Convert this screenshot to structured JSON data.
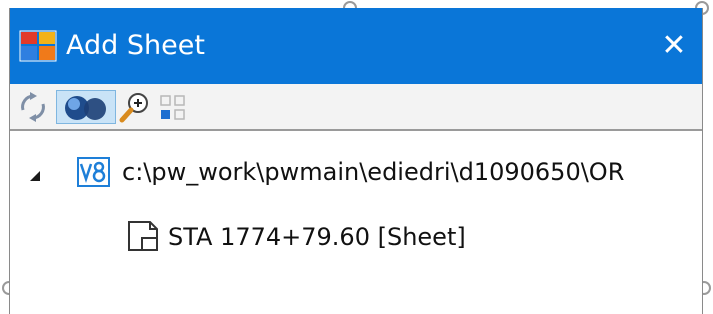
{
  "window": {
    "title": "Add Sheet",
    "close_glyph": "✕"
  },
  "toolbar": {
    "buttons": [
      {
        "name": "refresh-icon",
        "pressed": false
      },
      {
        "name": "globe-icon",
        "pressed": true
      },
      {
        "name": "zoom-in-icon",
        "pressed": false
      },
      {
        "name": "select-grid-icon",
        "pressed": false
      }
    ]
  },
  "tree": {
    "root": {
      "icon": "v8-dgn-file-icon",
      "label": "c:\\pw_work\\pwmain\\ediedri\\d1090650\\OR",
      "expanded": true,
      "children": [
        {
          "icon": "sheet-model-icon",
          "label": "STA 1774+79.60 [Sheet]"
        }
      ]
    }
  },
  "colors": {
    "titlebar": "#0a76d8",
    "toolbar_bg": "#f3f3f3",
    "pressed_bg": "#c9e3f7",
    "v8_blue": "#1e7fd8"
  }
}
